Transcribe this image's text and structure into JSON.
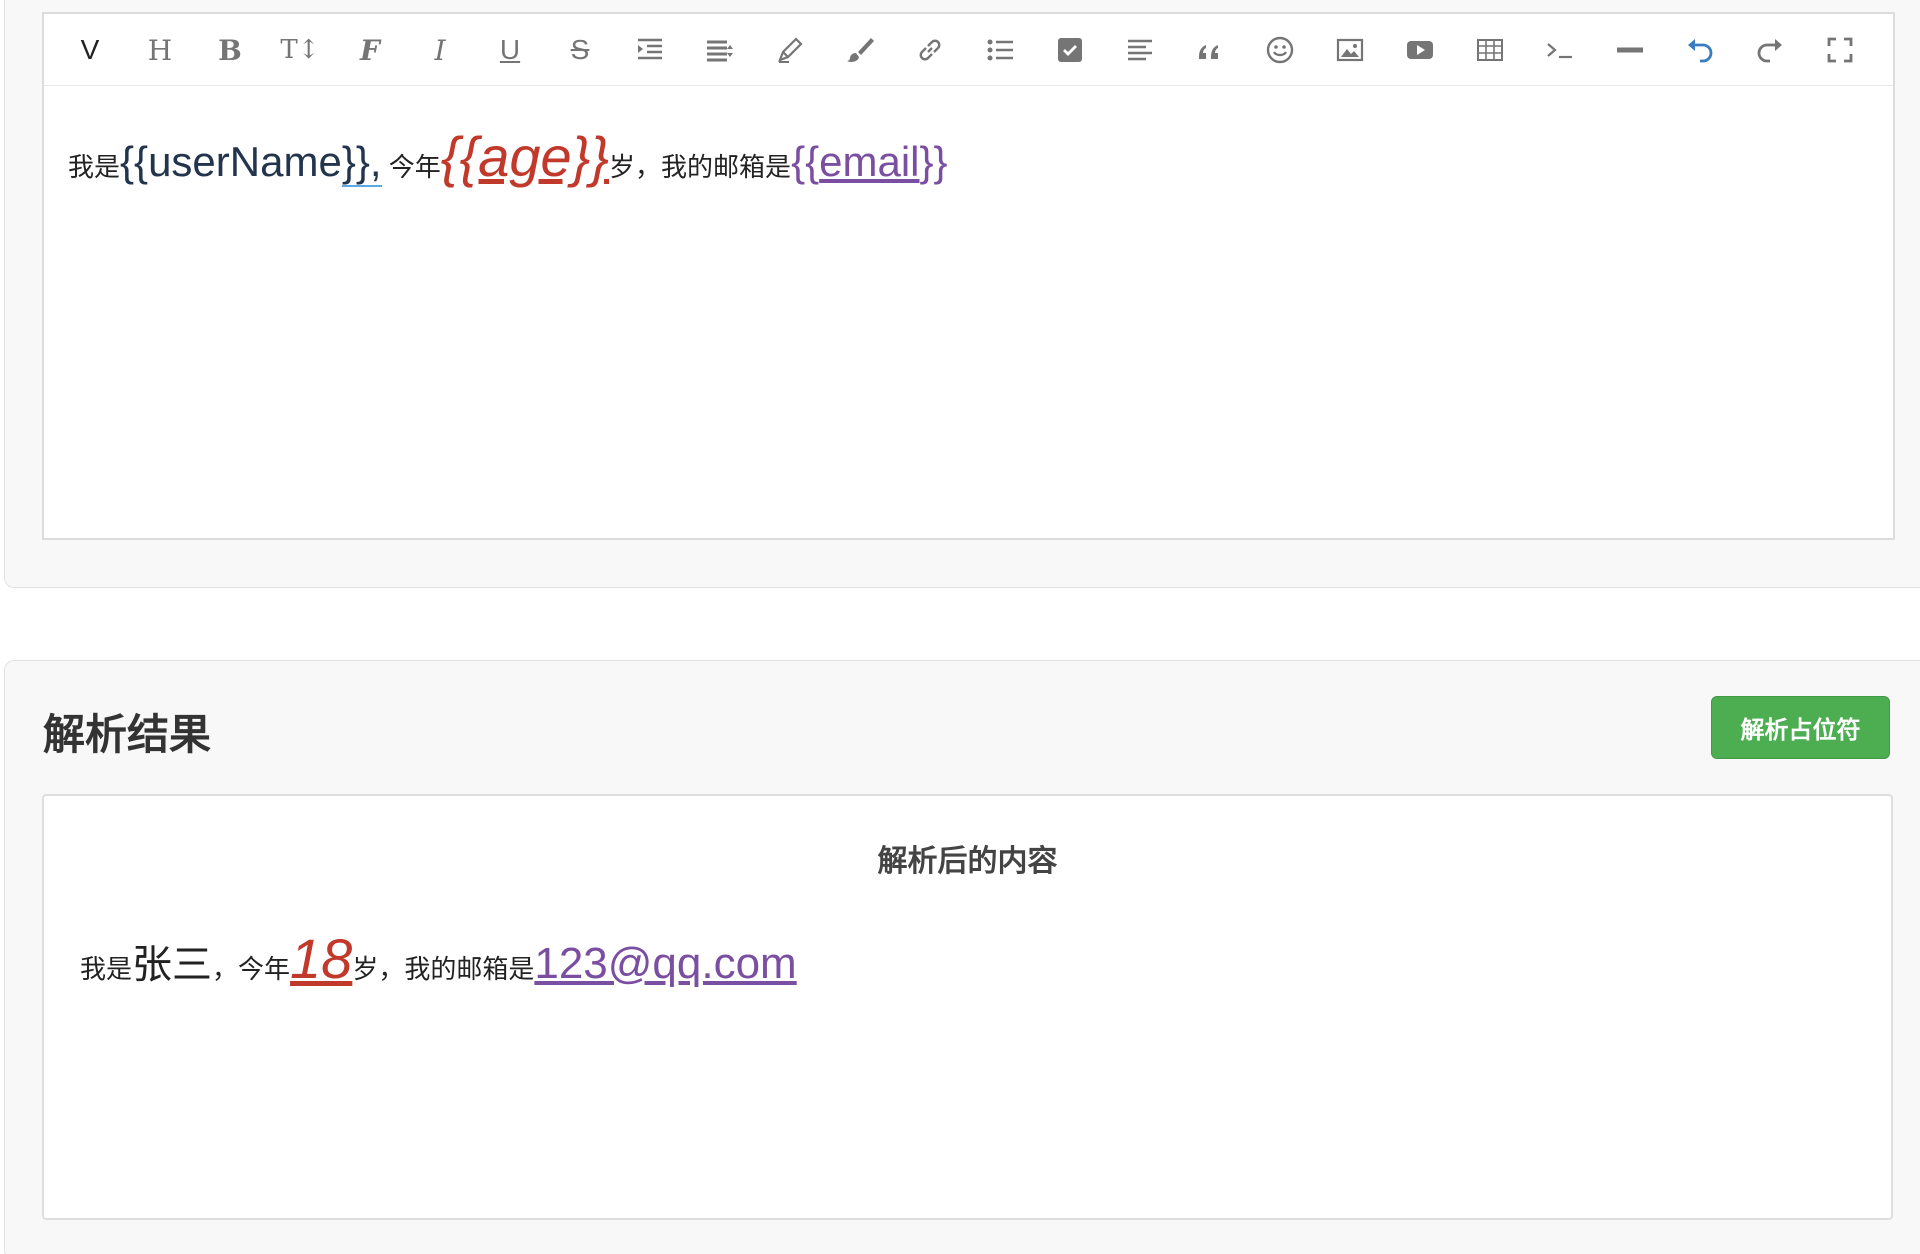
{
  "toolbar": {
    "items": [
      {
        "name": "vue-mode",
        "glyph": "V"
      },
      {
        "name": "heading",
        "glyph": "H"
      },
      {
        "name": "bold",
        "glyph": "B"
      },
      {
        "name": "font-size",
        "glyph": "T↕"
      },
      {
        "name": "font-family",
        "glyph": "F"
      },
      {
        "name": "italic",
        "glyph": "I"
      },
      {
        "name": "underline",
        "glyph": "U"
      },
      {
        "name": "strikethrough",
        "glyph": "S"
      }
    ]
  },
  "editor": {
    "prefix": "我是",
    "name_token_open": "{{userName",
    "name_token_close": "}},",
    "age_prefix": "今年",
    "age_token": "{{age}}",
    "age_suffix": "岁，我的邮箱是",
    "email_open": "{{",
    "email_inner": "email",
    "email_close": "}}"
  },
  "result_section": {
    "title": "解析结果",
    "parse_button": "解析占位符",
    "heading": "解析后的内容",
    "prefix": "我是",
    "name_value": "张三",
    "age_prefix": "，今年",
    "age_value": "18",
    "age_suffix": "岁，我的邮箱是",
    "email_value": "123@qq.com"
  },
  "colors": {
    "accent_green": "#4cae50",
    "age_red": "#c0392b",
    "email_purple": "#7a4ea0",
    "undo_blue": "#3a7cc2"
  }
}
